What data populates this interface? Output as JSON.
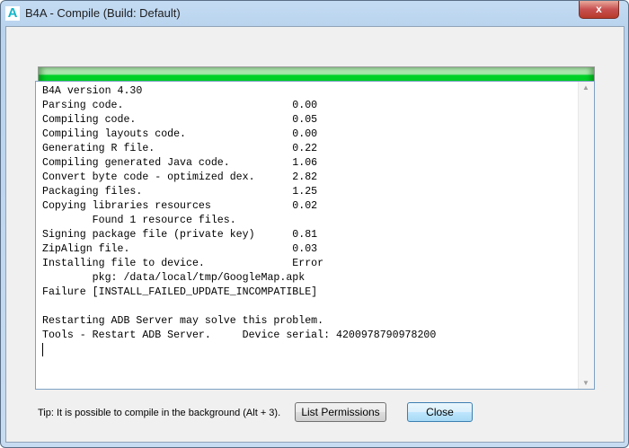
{
  "window": {
    "title": "B4A - Compile (Build: Default)",
    "app_icon": "A",
    "close_glyph": "x"
  },
  "progress": {
    "percent": 100,
    "color": "#00c820"
  },
  "log": {
    "lines": [
      "B4A version 4.30",
      "Parsing code.                           0.00",
      "Compiling code.                         0.05",
      "Compiling layouts code.                 0.00",
      "Generating R file.                      0.22",
      "Compiling generated Java code.          1.06",
      "Convert byte code - optimized dex.      2.82",
      "Packaging files.                        1.25",
      "Copying libraries resources             0.02",
      "        Found 1 resource files.",
      "Signing package file (private key)      0.81",
      "ZipAlign file.                          0.03",
      "Installing file to device.              Error",
      "        pkg: /data/local/tmp/GoogleMap.apk",
      "Failure [INSTALL_FAILED_UPDATE_INCOMPATIBLE]",
      "",
      "Restarting ADB Server may solve this problem.",
      "Tools - Restart ADB Server.     Device serial: 4200978790978200"
    ]
  },
  "footer": {
    "tip": "Tip: It is possible to compile in the background (Alt + 3).",
    "list_permissions": "List Permissions",
    "close": "Close"
  }
}
